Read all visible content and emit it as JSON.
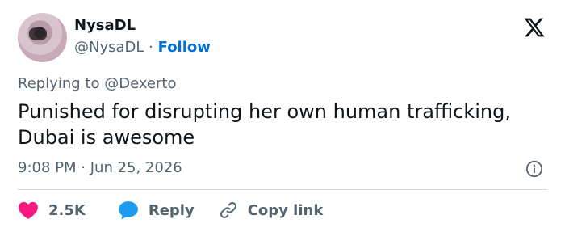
{
  "author": {
    "name": "NysaDL",
    "handle": "@NysaDL",
    "separator": "·",
    "follow_label": "Follow"
  },
  "reply_context": {
    "prefix": "Replying to",
    "mention": "@Dexerto"
  },
  "tweet": {
    "text": "Punished for disrupting her own human trafficking, Dubai is awesome",
    "time": "9:08 PM",
    "separator": "·",
    "date": "Jun 25, 2026"
  },
  "actions": {
    "like_count": "2.5K",
    "reply_label": "Reply",
    "copy_label": "Copy link"
  },
  "icons": {
    "brand": "x-logo-icon",
    "info": "info-icon",
    "like": "heart-icon",
    "reply": "speech-bubble-icon",
    "copy": "link-icon"
  },
  "colors": {
    "text": "#0f1419",
    "secondary": "#536471",
    "link": "#006fd6",
    "like": "#f91880",
    "reply": "#1d9bf0",
    "divider": "#cfd9de"
  }
}
